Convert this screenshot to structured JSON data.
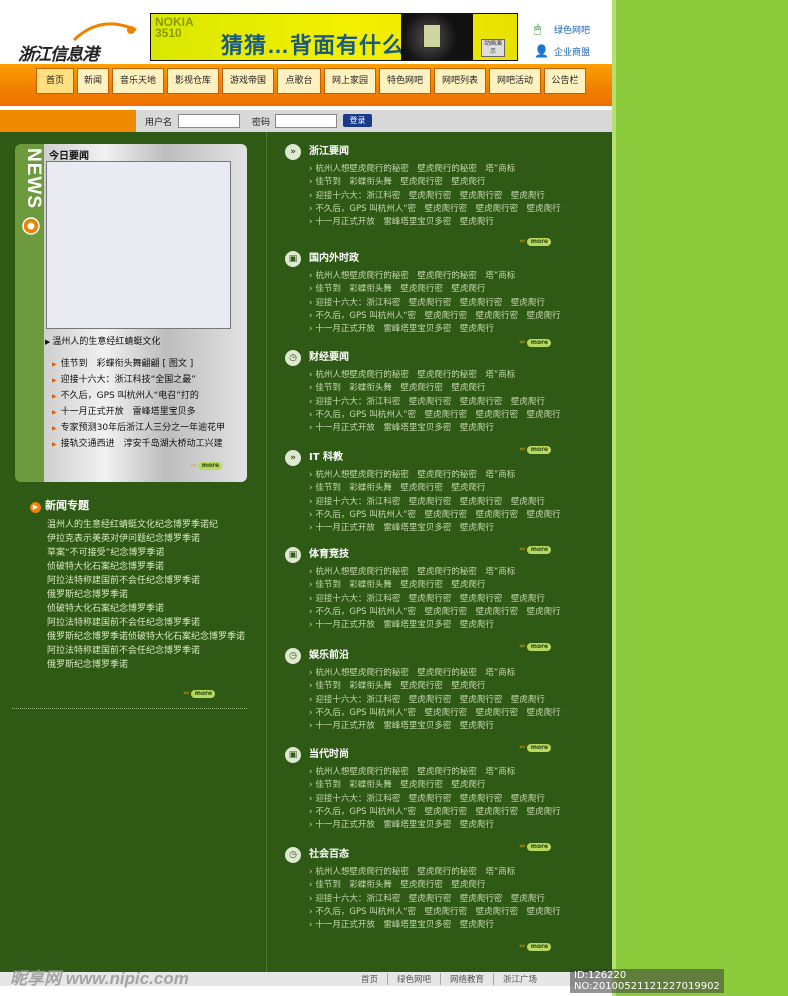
{
  "header": {
    "logo_text": "浙江信息港",
    "banner": {
      "brand": "NOKIA 3510",
      "slogan": "猜猜…背面有什么?",
      "demo": "动画演示"
    },
    "links": [
      {
        "label": "绿色网吧",
        "icon": "mouse-icon"
      },
      {
        "label": "企业商盟",
        "icon": "person-icon"
      }
    ]
  },
  "nav": {
    "tabs": [
      "首页",
      "新闻",
      "音乐天地",
      "影视仓库",
      "游戏帝国",
      "点歌台",
      "网上家园",
      "特色网吧",
      "网吧列表",
      "网吧活动",
      "公告栏"
    ]
  },
  "login": {
    "username_label": "用户名",
    "password_label": "密码",
    "submit_label": "登录"
  },
  "news_panel": {
    "vertical_label": "NEWS",
    "title": "今日要闻",
    "caption": "温州人的生意经红蜻蜓文化",
    "items": [
      "佳节到　彩蝶衔头舞翩翩 [ 图文 ]",
      "迎接十六大：浙江科技“全国之最”",
      "不久后，GPS 叫杭州人“电召”打的",
      "十一月正式开放　雷峰塔里宝贝多",
      "专家预测30年后浙江人三分之一年逾花甲",
      "接轨交通西进　淳安千岛湖大桥动工兴建"
    ],
    "more_label": "more"
  },
  "topics": {
    "title": "新闻专题",
    "items": [
      "温州人的生意经红蜻蜓文化纪念博罗季诺纪",
      "伊拉克表示美英对伊问题纪念博罗季诺",
      "草案“不可接受”纪念博罗季诺",
      "侦破特大化石案纪念博罗季诺",
      "阿拉法特称建国前不会任纪念博罗季诺",
      "俄罗斯纪念博罗季诺",
      "侦破特大化石案纪念博罗季诺",
      "阿拉法特称建国前不会任纪念博罗季诺",
      "俄罗斯纪念博罗季诺侦破特大化石案纪念博罗季诺",
      "阿拉法特称建国前不会任纪念博罗季诺",
      "俄罗斯纪念博罗季诺"
    ],
    "more_label": "more"
  },
  "sections": [
    {
      "title": "浙江要闻",
      "icon": "double-arrow-icon"
    },
    {
      "title": "国内外时政",
      "icon": "screen-icon"
    },
    {
      "title": "财经要闻",
      "icon": "clock-icon"
    },
    {
      "title": "IT 科教",
      "icon": "double-arrow-icon"
    },
    {
      "title": "体育竞技",
      "icon": "screen-icon"
    },
    {
      "title": "娱乐前沿",
      "icon": "clock-icon"
    },
    {
      "title": "当代时尚",
      "icon": "screen-icon"
    },
    {
      "title": "社会百态",
      "icon": "clock-icon"
    }
  ],
  "section_items": [
    "杭州人想壁虎爬行的秘密　壁虎爬行的秘密　塔”商标",
    "佳节到　彩蝶衔头舞　壁虎爬行密　壁虎爬行",
    "迎接十六大：浙江科密　壁虎爬行密　壁虎爬行密　壁虎爬行",
    "不久后，GPS 叫杭州人“密　壁虎爬行密　壁虎爬行密　壁虎爬行",
    "十一月正式开放　雷峰塔里宝贝多密　壁虎爬行"
  ],
  "section_more_label": "more",
  "footer": {
    "links": [
      "首页",
      "绿色网吧",
      "网络教育",
      "浙江广场"
    ],
    "watermark": "昵享网 www.nipic.com",
    "image_id": "ID:126220 NO:20100521121227019902"
  },
  "colors": {
    "green_bg": "#2f5a16",
    "orange": "#f08000",
    "lime": "#8ccc3c"
  }
}
